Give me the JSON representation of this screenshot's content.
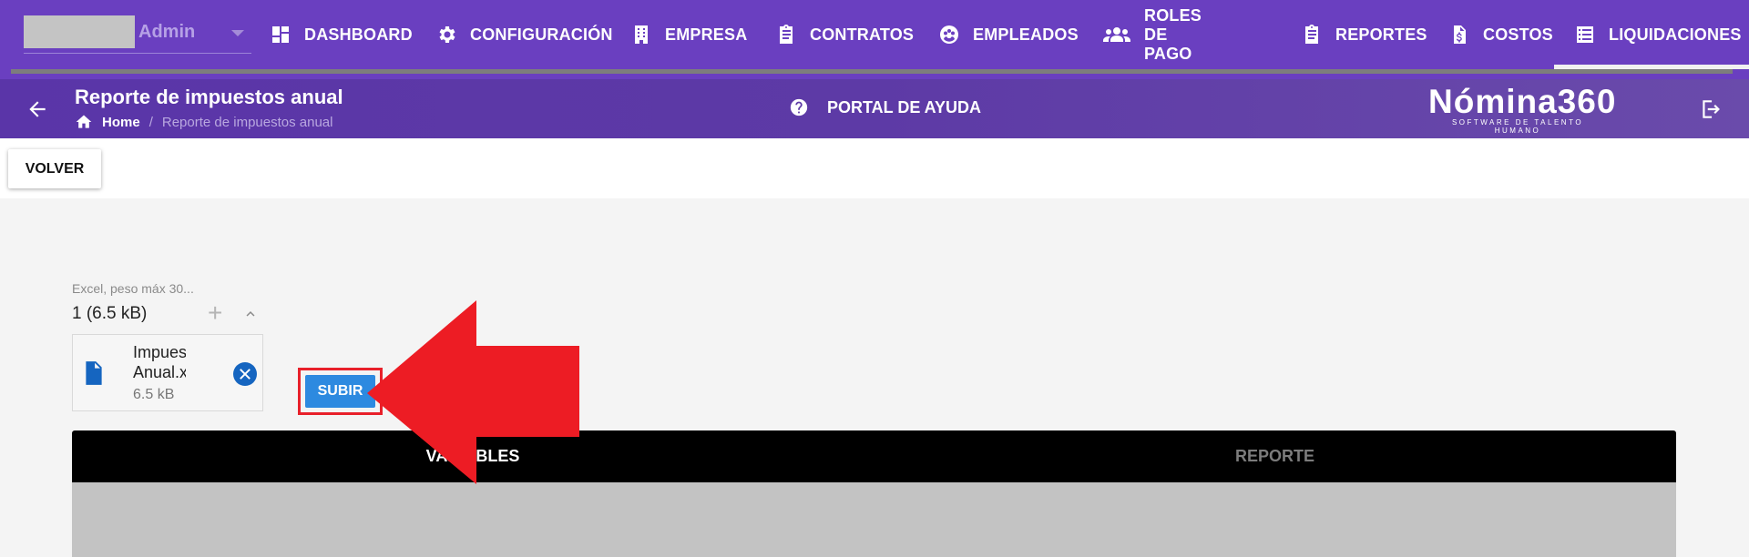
{
  "account": {
    "name": "Admin"
  },
  "nav": [
    {
      "label": "DASHBOARD",
      "icon": "dashboard-icon"
    },
    {
      "label": "CONFIGURACIÓN",
      "icon": "gear-icon"
    },
    {
      "label": "EMPRESA",
      "icon": "building-icon"
    },
    {
      "label": "CONTRATOS",
      "icon": "clipboard-icon"
    },
    {
      "label": "EMPLEADOS",
      "icon": "people-circle-icon"
    },
    {
      "label": "ROLES DE PAGO",
      "icon": "group-icon"
    },
    {
      "label": "REPORTES",
      "icon": "clipboard-list-icon"
    },
    {
      "label": "COSTOS",
      "icon": "invoice-dollar-icon"
    },
    {
      "label": "LIQUIDACIONES",
      "icon": "list-icon",
      "active": true
    }
  ],
  "header": {
    "title": "Reporte de impuestos anual",
    "breadcrumb": {
      "home": "Home",
      "separator": "/",
      "current": "Reporte de impuestos anual"
    },
    "help": "PORTAL DE AYUDA",
    "logo": {
      "name": "Nómina360",
      "tagline": "SOFTWARE DE TALENTO HUMANO"
    }
  },
  "actions": {
    "back": "VOLVER"
  },
  "uploader": {
    "label": "Excel, peso máx 30...",
    "count": "1 (6.5 kB)",
    "add": "+",
    "file": {
      "name_line1": "Impuesto",
      "name_line2": "Anual.xls",
      "size": "6.5 kB"
    },
    "submit": "SUBIR"
  },
  "tabs": [
    {
      "label": "VARIABLES",
      "active": true
    },
    {
      "label": "REPORTE",
      "active": false
    }
  ],
  "colors": {
    "nav_bg": "#6a3fc0",
    "subheader_bg": "#5a35a8",
    "primary": "#2d8ae0",
    "file_icon": "#1565c0",
    "callout": "#ed1c24"
  }
}
